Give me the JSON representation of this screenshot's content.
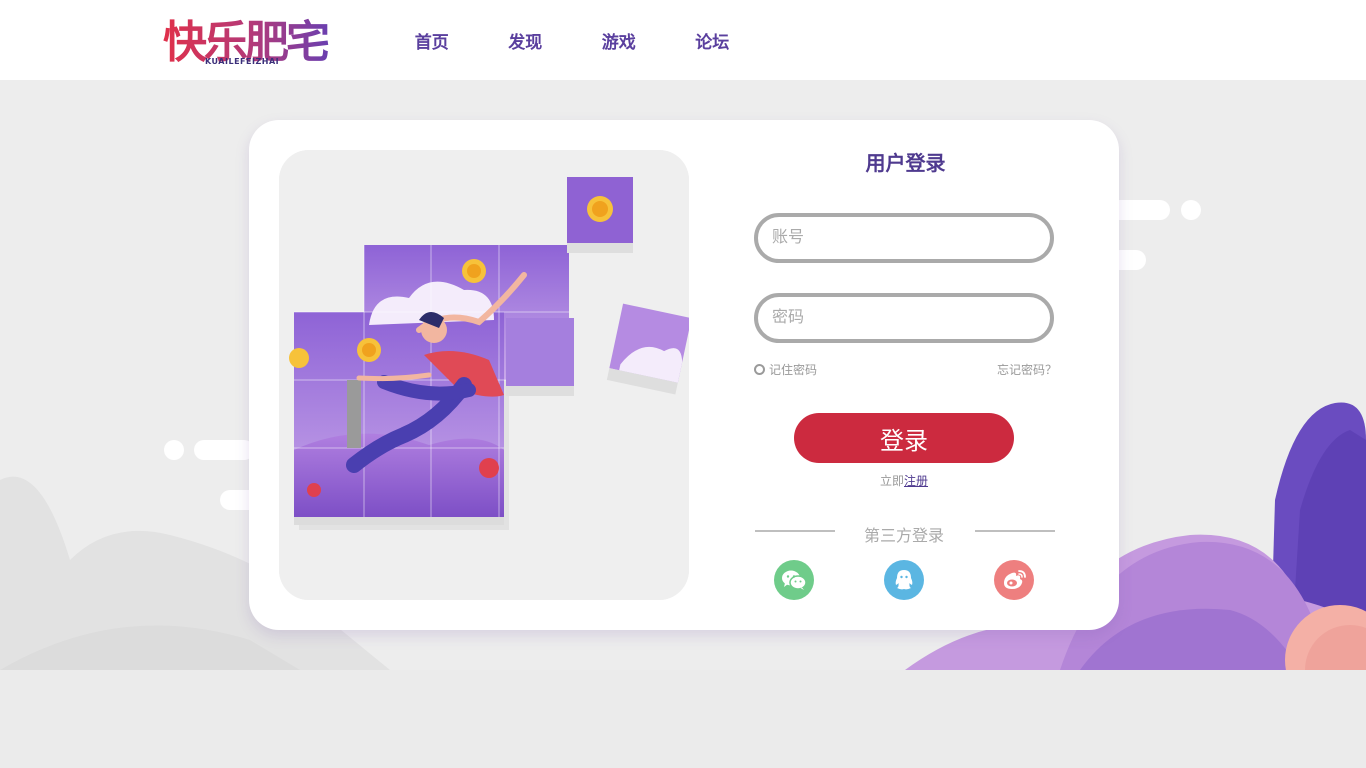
{
  "header": {
    "logo_main": "快乐肥宅",
    "logo_sub": "KUAILEFEIZHAI",
    "nav": [
      "首页",
      "发现",
      "游戏",
      "论坛"
    ]
  },
  "login": {
    "title": "用户登录",
    "account_placeholder": "账号",
    "password_placeholder": "密码",
    "remember_label": "记住密码",
    "forgot_label": "忘记密码？",
    "submit_label": "登录",
    "register_prefix": "立即",
    "register_link": "注册",
    "third_party_label": "第三方登录",
    "third_party_icons": [
      "wechat-icon",
      "qq-icon",
      "weibo-icon"
    ]
  },
  "colors": {
    "brand_purple": "#5a3f9e",
    "login_button": "#cc2a3f",
    "wechat": "#6fcc8a",
    "qq": "#5bb6e2",
    "weibo": "#ee7f7f"
  }
}
